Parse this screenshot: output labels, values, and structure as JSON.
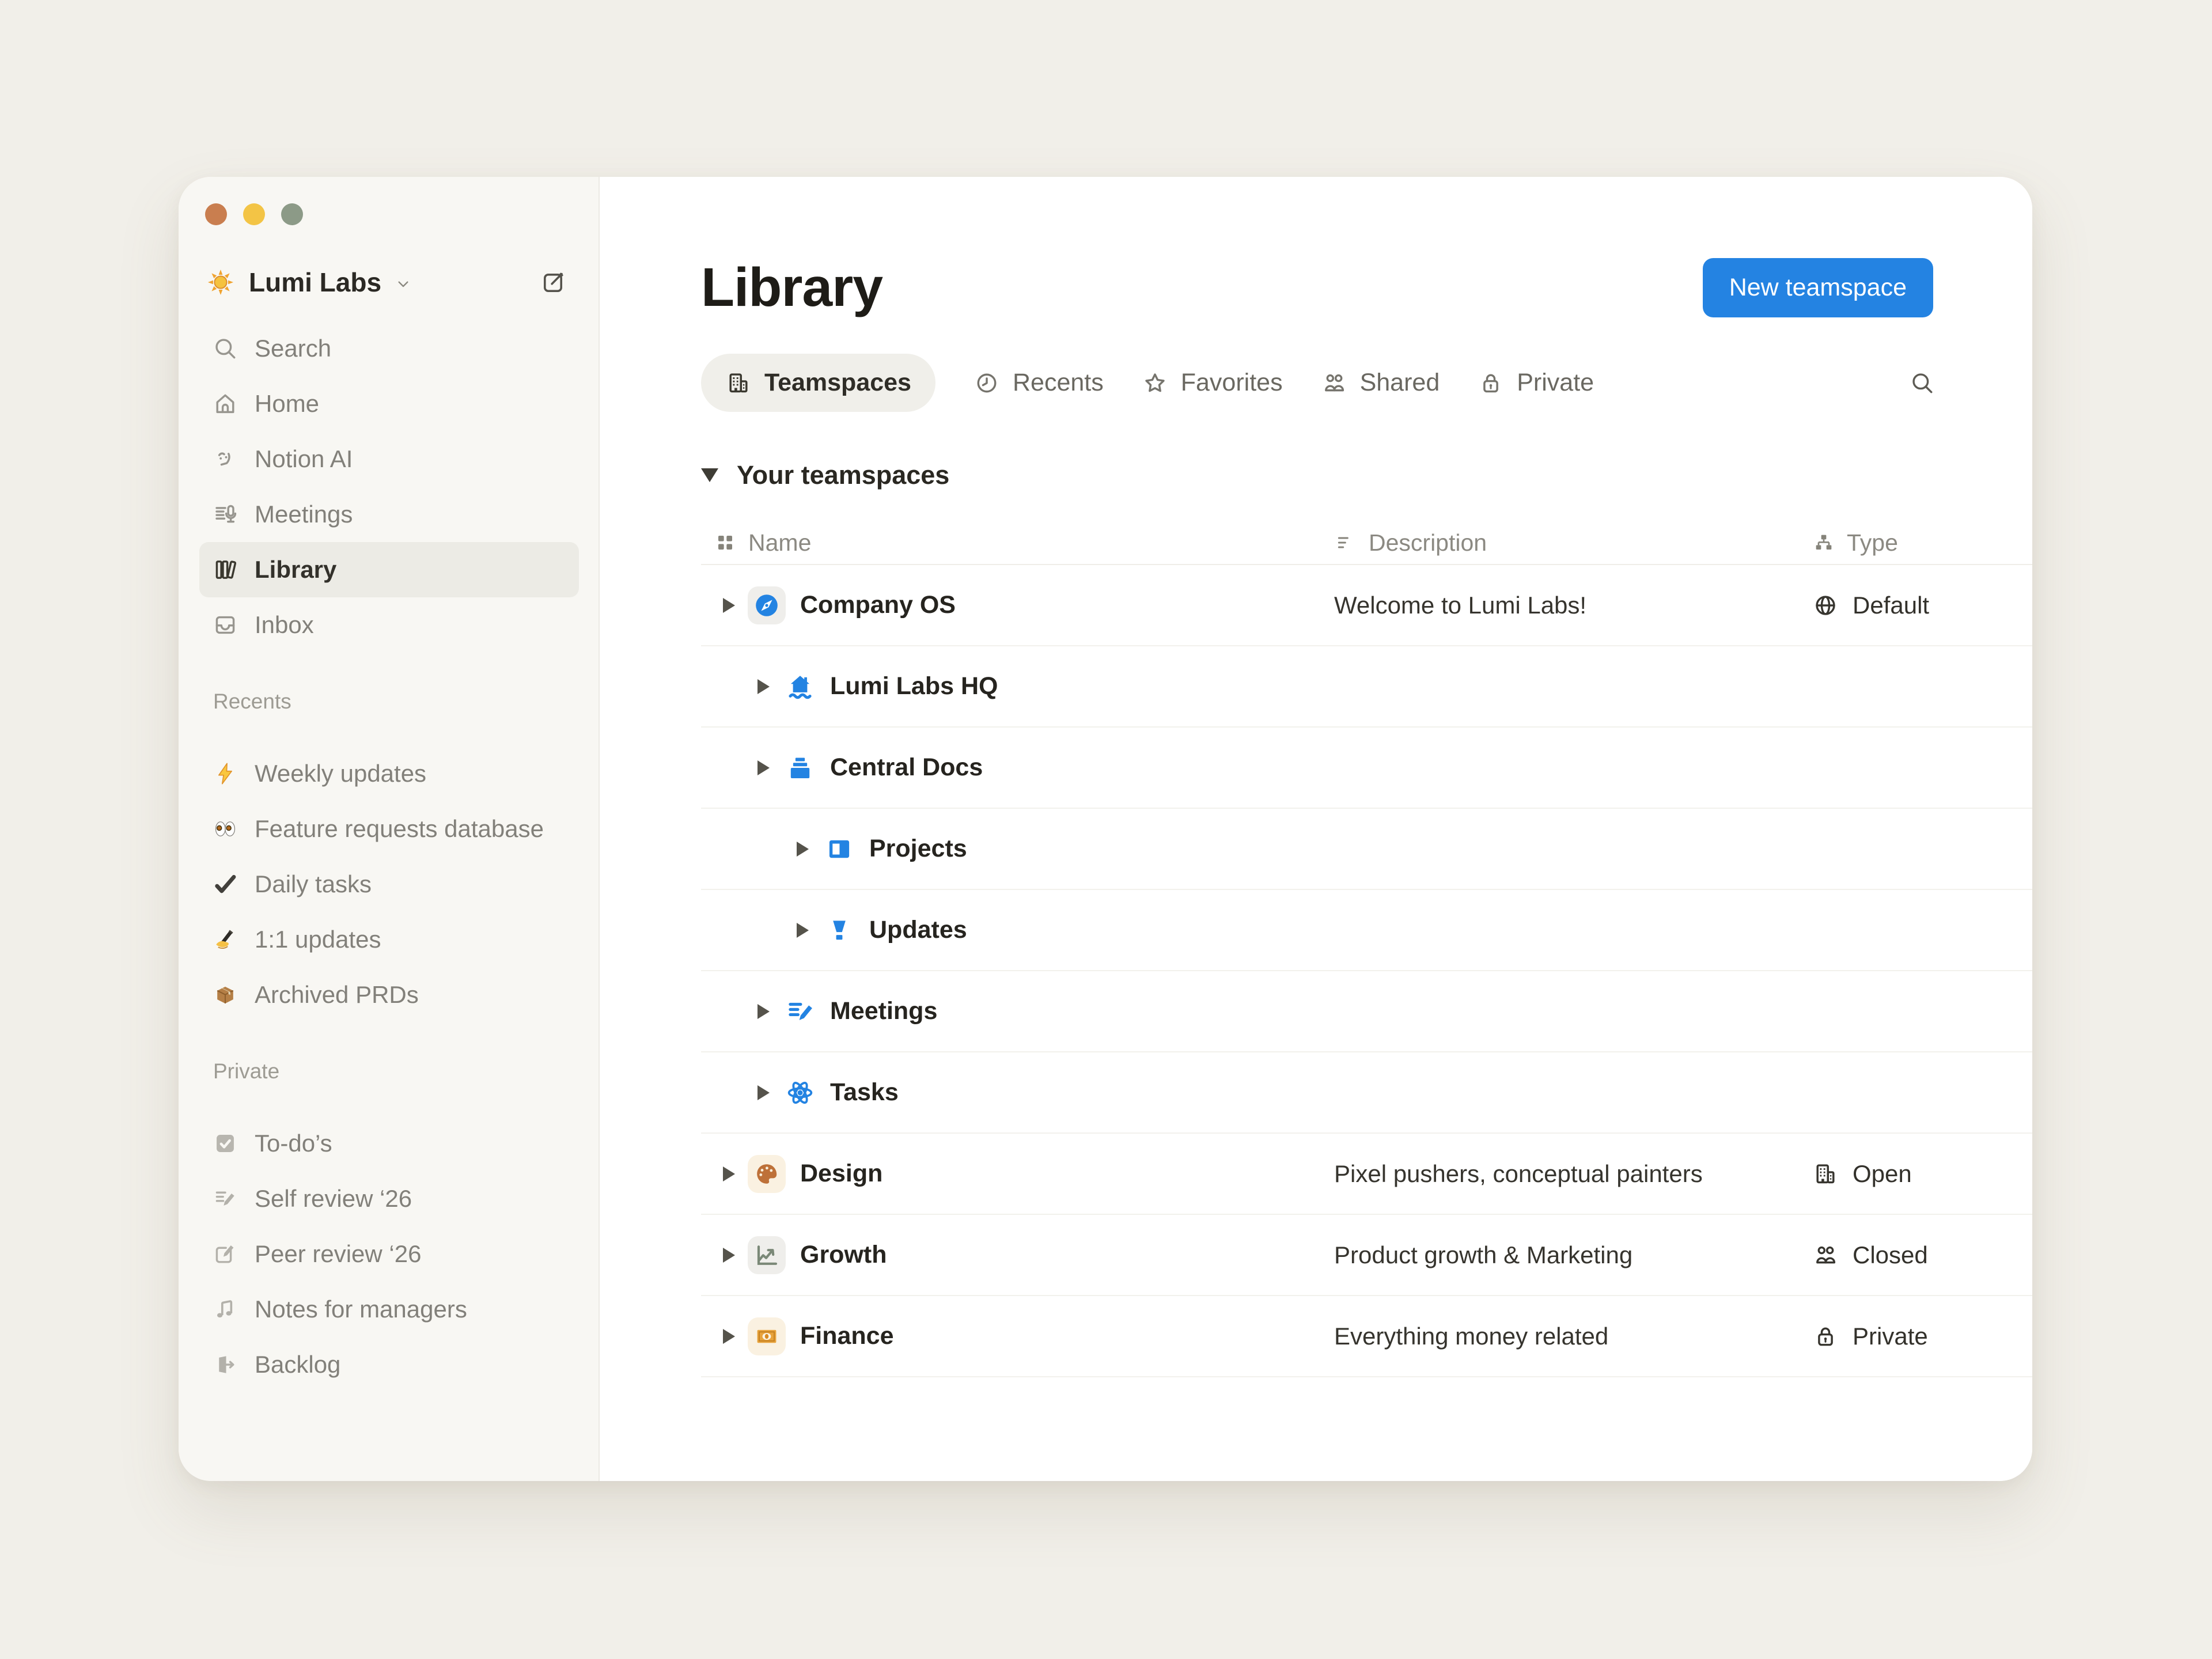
{
  "window": {
    "traffic_lights": {
      "close": "#C97E4F",
      "minimize": "#F3C445",
      "zoom": "#8C9A87"
    }
  },
  "sidebar": {
    "workspace": {
      "name": "Lumi Labs",
      "icon": "sun"
    },
    "nav": [
      {
        "icon": "magnifier",
        "label": "Search"
      },
      {
        "icon": "home",
        "label": "Home"
      },
      {
        "icon": "notion-ai",
        "label": "Notion AI"
      },
      {
        "icon": "meetings-mic",
        "label": "Meetings"
      },
      {
        "icon": "library-books",
        "label": "Library",
        "active": true
      },
      {
        "icon": "inbox",
        "label": "Inbox"
      }
    ],
    "recents": {
      "label": "Recents",
      "items": [
        {
          "icon": "lightning",
          "label": "Weekly updates"
        },
        {
          "icon": "eyes",
          "label": "Feature requests database"
        },
        {
          "icon": "check",
          "label": "Daily tasks"
        },
        {
          "icon": "writing-hand",
          "label": "1:1 updates"
        },
        {
          "icon": "package",
          "label": "Archived PRDs"
        }
      ]
    },
    "private": {
      "label": "Private",
      "items": [
        {
          "icon": "todo-checkbox",
          "label": "To-do’s"
        },
        {
          "icon": "list-pencil",
          "label": "Self review ‘26"
        },
        {
          "icon": "square-pencil",
          "label": "Peer review ‘26"
        },
        {
          "icon": "music-note",
          "label": "Notes for managers"
        },
        {
          "icon": "door-arrow",
          "label": "Backlog"
        }
      ]
    }
  },
  "main": {
    "title": "Library",
    "new_button": "New teamspace",
    "tabs": [
      {
        "icon": "building",
        "label": "Teamspaces",
        "active": true
      },
      {
        "icon": "clock",
        "label": "Recents"
      },
      {
        "icon": "star",
        "label": "Favorites"
      },
      {
        "icon": "people",
        "label": "Shared"
      },
      {
        "icon": "lock",
        "label": "Private"
      }
    ],
    "section": "Your teamspaces",
    "table": {
      "headers": {
        "name": "Name",
        "description": "Description",
        "type": "Type"
      },
      "rows": [
        {
          "level": 0,
          "chip": "gray",
          "icon": "compass",
          "name": "Company OS",
          "description": "Welcome to Lumi Labs!",
          "type_icon": "globe",
          "type_label": "Default"
        },
        {
          "level": 1,
          "icon": "hq-house",
          "name": "Lumi Labs HQ"
        },
        {
          "level": 1,
          "icon": "docs-stack",
          "name": "Central Docs"
        },
        {
          "level": 2,
          "icon": "projects-frame",
          "name": "Projects"
        },
        {
          "level": 2,
          "icon": "updates-funnel",
          "name": "Updates"
        },
        {
          "level": 1,
          "icon": "meetings-pencil",
          "name": "Meetings"
        },
        {
          "level": 1,
          "icon": "atom",
          "name": "Tasks"
        },
        {
          "level": 0,
          "chip": "cream",
          "icon": "palette",
          "name": "Design",
          "description": "Pixel pushers, conceptual painters",
          "type_icon": "building",
          "type_label": "Open"
        },
        {
          "level": 0,
          "chip": "gray",
          "icon": "chart-up",
          "name": "Growth",
          "description": "Product growth & Marketing",
          "type_icon": "people",
          "type_label": "Closed"
        },
        {
          "level": 0,
          "chip": "cream",
          "icon": "banknote",
          "name": "Finance",
          "description": "Everything money related",
          "type_icon": "lock",
          "type_label": "Private"
        }
      ]
    },
    "colors": {
      "accent_blue": "#2483E2",
      "row_icon_blue": "#2383E2",
      "chip_gray": "#EFEEEB",
      "chip_cream": "#FAF1E1"
    }
  }
}
